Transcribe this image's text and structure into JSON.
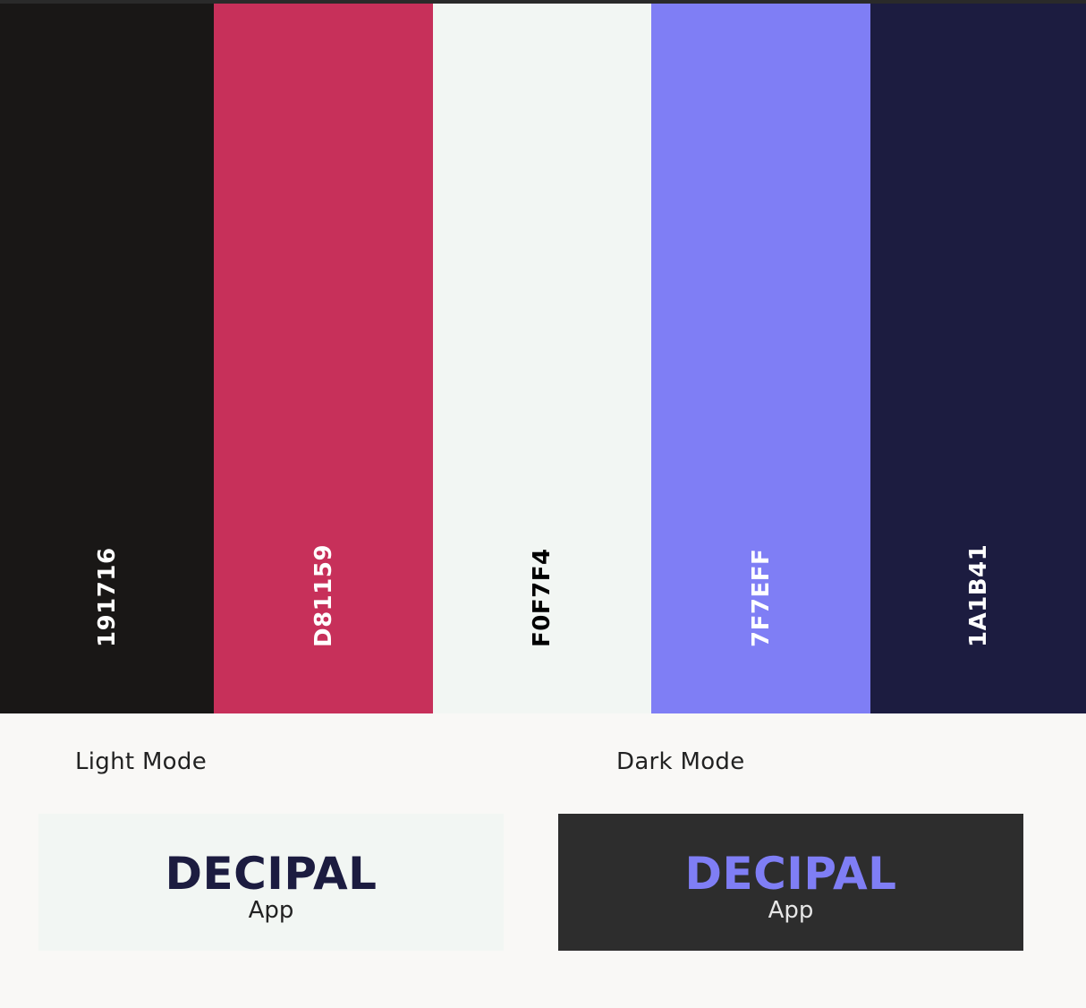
{
  "palette": {
    "swatches": [
      {
        "hex": "191716",
        "color": "#191716",
        "text_color": "#FFFFFF"
      },
      {
        "hex": "D81159",
        "color": "#C7305A",
        "text_color": "#FFFFFF"
      },
      {
        "hex": "F0F7F4",
        "color": "#F2F6F3",
        "text_color": "#000000"
      },
      {
        "hex": "7F7EFF",
        "color": "#7F7EF5",
        "text_color": "#FFFFFF"
      },
      {
        "hex": "1A1B41",
        "color": "#1C1C40",
        "text_color": "#FFFFFF"
      }
    ]
  },
  "light_mode": {
    "label": "Light Mode",
    "brand": "DECIPAL",
    "sub": "App",
    "background": "#F2F6F3",
    "brand_color": "#1C1C40",
    "sub_color": "#222222"
  },
  "dark_mode": {
    "label": "Dark Mode",
    "brand": "DECIPAL",
    "sub": "App",
    "background": "#2D2D2D",
    "brand_color": "#7F7EF5",
    "sub_color": "#E6E6E6"
  }
}
